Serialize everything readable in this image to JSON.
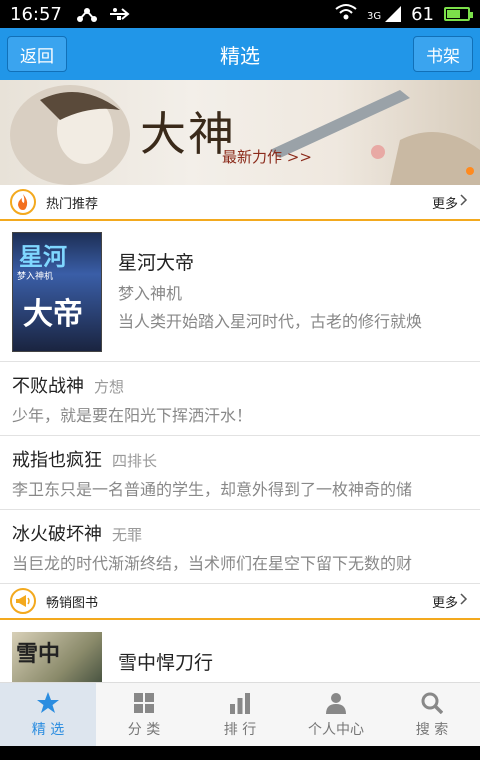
{
  "status_bar": {
    "time": "16:57",
    "network": "3G",
    "battery": "61",
    "battery_level": 0.61,
    "left_icons": [
      "share-icon",
      "usb-icon"
    ],
    "right_icons": [
      "wifi-icon",
      "signal-icon",
      "battery-icon"
    ]
  },
  "header": {
    "back_label": "返回",
    "title": "精选",
    "bookshelf_label": "书架"
  },
  "banner": {
    "headline": "大神",
    "subline": "最新力作 >>"
  },
  "sections": {
    "hot": {
      "label": "热门推荐",
      "more": "更多",
      "icon": "flame-icon"
    },
    "bestseller": {
      "label": "畅销图书",
      "more": "更多",
      "icon": "megaphone-icon"
    }
  },
  "featured": {
    "title": "星河大帝",
    "author": "梦入神机",
    "description": "当人类开始踏入星河时代，古老的修行就焕",
    "cover_text_top": "星河",
    "cover_text_author": "梦入神机",
    "cover_text_big": "大帝"
  },
  "list": [
    {
      "title": "不败战神",
      "author": "方想",
      "description": "少年，就是要在阳光下挥洒汗水！"
    },
    {
      "title": "戒指也疯狂",
      "author": "四排长",
      "description": "李卫东只是一名普通的学生，却意外得到了一枚神奇的储"
    },
    {
      "title": "冰火破坏神",
      "author": "无罪",
      "description": "当巨龙的时代渐渐终结，当术师们在星空下留下无数的财"
    }
  ],
  "featured2": {
    "title": "雪中悍刀行",
    "cover_text": "雪中"
  },
  "tabs": [
    {
      "label": "精 选",
      "icon": "star-icon",
      "active": true
    },
    {
      "label": "分 类",
      "icon": "grid-icon",
      "active": false
    },
    {
      "label": "排 行",
      "icon": "bar-chart-icon",
      "active": false
    },
    {
      "label": "个人中心",
      "icon": "person-icon",
      "active": false
    },
    {
      "label": "搜 索",
      "icon": "search-icon",
      "active": false
    }
  ],
  "colors": {
    "accent": "#2196e8",
    "section_underline": "#f3a91e",
    "active_tab": "#2b8de0"
  }
}
